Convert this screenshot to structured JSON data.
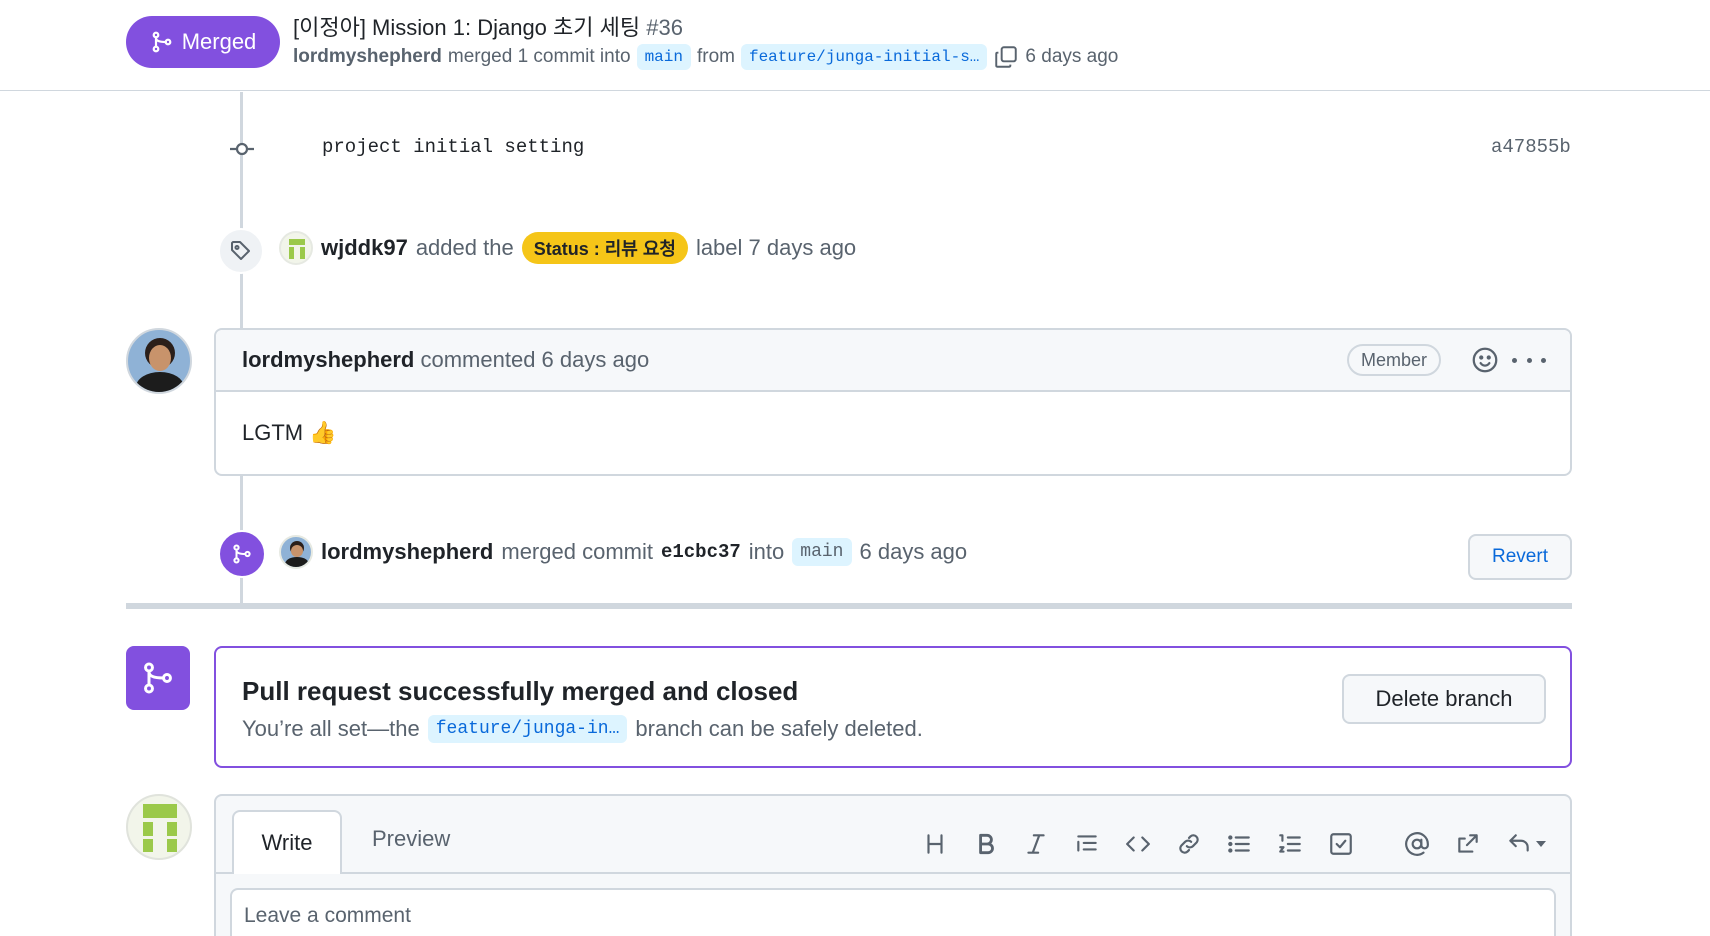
{
  "header": {
    "status": "Merged",
    "title": "[이정아] Mission 1: Django 초기 세팅",
    "number": "#36",
    "author": "lordmyshepherd",
    "merge_text": "merged 1 commit into",
    "base_branch": "main",
    "from_text": "from",
    "head_branch": "feature/junga-initial-s…",
    "time": "6 days ago"
  },
  "commit": {
    "message": "project initial setting",
    "sha": "a47855b"
  },
  "label_event": {
    "user": "wjddk97",
    "text_before": "added the",
    "label": "Status : 리뷰 요청",
    "text_after": "label 7 days ago"
  },
  "comment": {
    "author": "lordmyshepherd",
    "action": "commented 6 days ago",
    "role": "Member",
    "body": "LGTM 👍"
  },
  "merge_event": {
    "user": "lordmyshepherd",
    "text": "merged commit",
    "commit": "e1cbc37",
    "into": "into",
    "branch": "main",
    "time": "6 days ago",
    "revert_label": "Revert"
  },
  "merge_box": {
    "title": "Pull request successfully merged and closed",
    "text_before": "You’re all set—the",
    "branch": "feature/junga-in…",
    "text_after": "branch can be safely deleted.",
    "delete_label": "Delete branch"
  },
  "editor": {
    "tab_write": "Write",
    "tab_preview": "Preview",
    "placeholder": "Leave a comment"
  },
  "colors": {
    "merged_purple": "#8250df",
    "label_yellow": "#f5c518",
    "link_blue": "#0969da"
  }
}
